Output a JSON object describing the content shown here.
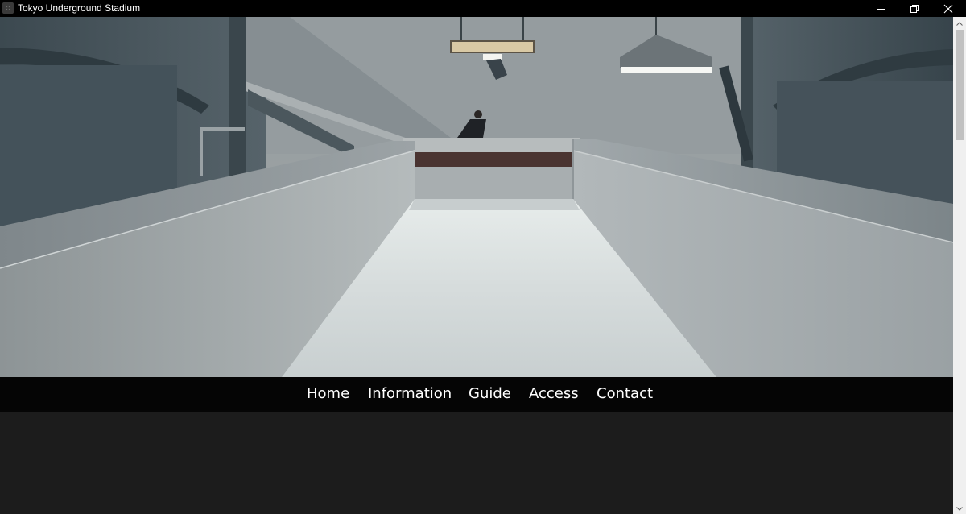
{
  "window": {
    "title": "Tokyo Underground Stadium",
    "app_icon": "app-icon",
    "controls": [
      "minimize-icon",
      "restore-icon",
      "close-icon"
    ]
  },
  "hero": {
    "image": "concrete-stairway-ramp-photo"
  },
  "nav": {
    "items": [
      {
        "label": "Home"
      },
      {
        "label": "Information"
      },
      {
        "label": "Guide"
      },
      {
        "label": "Access"
      },
      {
        "label": "Contact"
      }
    ]
  },
  "colors": {
    "titlebar": "#000000",
    "navbar": "#050505",
    "content_bg": "#1c1c1c",
    "nav_text": "#ffffff"
  }
}
